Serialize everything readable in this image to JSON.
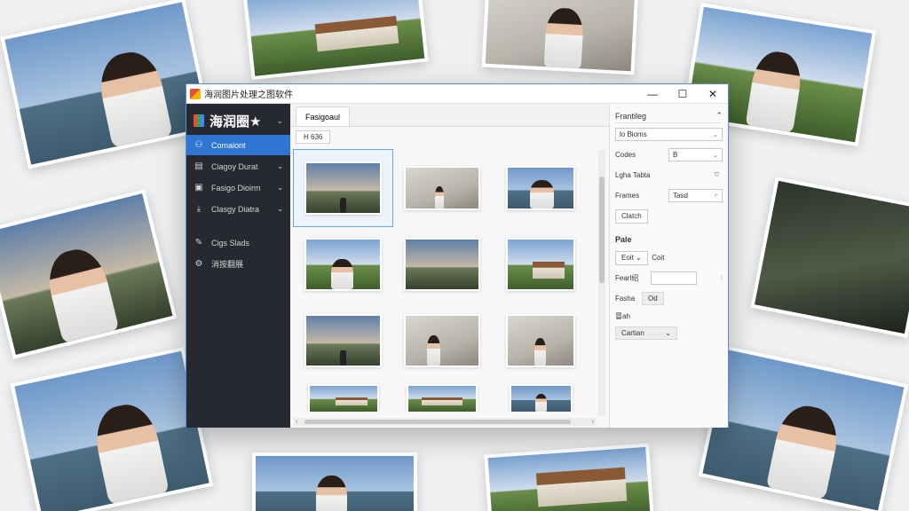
{
  "window": {
    "title": "海润图片处理之图软件",
    "minimize": "—",
    "maximize": "☐",
    "close": "✕"
  },
  "sidebar": {
    "brand": "海润圈★",
    "items": [
      {
        "label": "Comaiont",
        "icon": "group-icon"
      },
      {
        "label": "Ciagoy Durat",
        "icon": "grid-icon"
      },
      {
        "label": "Fasigo Dioirm",
        "icon": "folder-icon"
      },
      {
        "label": "Clasgy Diatra",
        "icon": "download-icon"
      },
      {
        "label": "Cigs Slads",
        "icon": "wrench-icon"
      },
      {
        "label": "消按翻展",
        "icon": "gear-icon"
      }
    ]
  },
  "main": {
    "tab": "Fasigoaul",
    "tab_tools": "⊞ ⁝",
    "crumb": "H 636"
  },
  "panel": {
    "title": "Frantileg",
    "row1_prefix": "lo",
    "row1_value": "Bioms",
    "codes_label": "Codes",
    "codes_value": "B",
    "tgha_label": "Lgha Tabta",
    "frames_label": "Frames",
    "frames_value": "Tasd",
    "match_button": "Clatch",
    "section": "Pale",
    "edit_value": "Eoit",
    "edit_label": "Coit",
    "fearlab_label": "Fearl绍",
    "fanha_label": "Fasha",
    "fanha_value": "Od",
    "sub_label": "冒ah",
    "combo_value": "Cartian"
  },
  "colors": {
    "accent": "#2f75d2",
    "sidebar_bg": "#262a30",
    "window_border": "#5a8fd6"
  }
}
